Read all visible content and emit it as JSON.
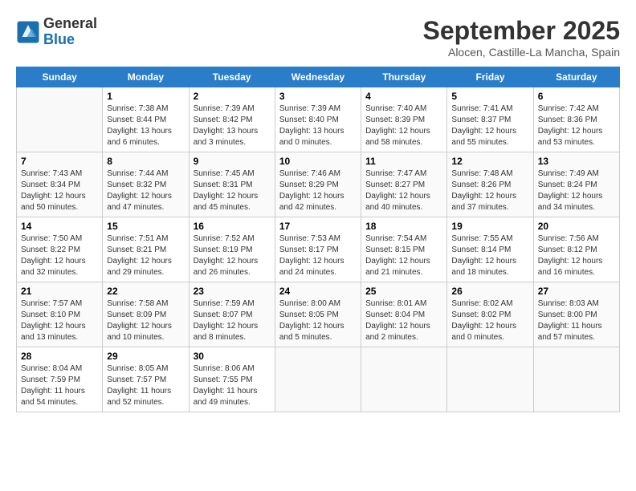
{
  "header": {
    "logo_general": "General",
    "logo_blue": "Blue",
    "month_title": "September 2025",
    "location": "Alocen, Castille-La Mancha, Spain"
  },
  "days_of_week": [
    "Sunday",
    "Monday",
    "Tuesday",
    "Wednesday",
    "Thursday",
    "Friday",
    "Saturday"
  ],
  "weeks": [
    [
      {
        "day": "",
        "info": ""
      },
      {
        "day": "1",
        "info": "Sunrise: 7:38 AM\nSunset: 8:44 PM\nDaylight: 13 hours\nand 6 minutes."
      },
      {
        "day": "2",
        "info": "Sunrise: 7:39 AM\nSunset: 8:42 PM\nDaylight: 13 hours\nand 3 minutes."
      },
      {
        "day": "3",
        "info": "Sunrise: 7:39 AM\nSunset: 8:40 PM\nDaylight: 13 hours\nand 0 minutes."
      },
      {
        "day": "4",
        "info": "Sunrise: 7:40 AM\nSunset: 8:39 PM\nDaylight: 12 hours\nand 58 minutes."
      },
      {
        "day": "5",
        "info": "Sunrise: 7:41 AM\nSunset: 8:37 PM\nDaylight: 12 hours\nand 55 minutes."
      },
      {
        "day": "6",
        "info": "Sunrise: 7:42 AM\nSunset: 8:36 PM\nDaylight: 12 hours\nand 53 minutes."
      }
    ],
    [
      {
        "day": "7",
        "info": "Sunrise: 7:43 AM\nSunset: 8:34 PM\nDaylight: 12 hours\nand 50 minutes."
      },
      {
        "day": "8",
        "info": "Sunrise: 7:44 AM\nSunset: 8:32 PM\nDaylight: 12 hours\nand 47 minutes."
      },
      {
        "day": "9",
        "info": "Sunrise: 7:45 AM\nSunset: 8:31 PM\nDaylight: 12 hours\nand 45 minutes."
      },
      {
        "day": "10",
        "info": "Sunrise: 7:46 AM\nSunset: 8:29 PM\nDaylight: 12 hours\nand 42 minutes."
      },
      {
        "day": "11",
        "info": "Sunrise: 7:47 AM\nSunset: 8:27 PM\nDaylight: 12 hours\nand 40 minutes."
      },
      {
        "day": "12",
        "info": "Sunrise: 7:48 AM\nSunset: 8:26 PM\nDaylight: 12 hours\nand 37 minutes."
      },
      {
        "day": "13",
        "info": "Sunrise: 7:49 AM\nSunset: 8:24 PM\nDaylight: 12 hours\nand 34 minutes."
      }
    ],
    [
      {
        "day": "14",
        "info": "Sunrise: 7:50 AM\nSunset: 8:22 PM\nDaylight: 12 hours\nand 32 minutes."
      },
      {
        "day": "15",
        "info": "Sunrise: 7:51 AM\nSunset: 8:21 PM\nDaylight: 12 hours\nand 29 minutes."
      },
      {
        "day": "16",
        "info": "Sunrise: 7:52 AM\nSunset: 8:19 PM\nDaylight: 12 hours\nand 26 minutes."
      },
      {
        "day": "17",
        "info": "Sunrise: 7:53 AM\nSunset: 8:17 PM\nDaylight: 12 hours\nand 24 minutes."
      },
      {
        "day": "18",
        "info": "Sunrise: 7:54 AM\nSunset: 8:15 PM\nDaylight: 12 hours\nand 21 minutes."
      },
      {
        "day": "19",
        "info": "Sunrise: 7:55 AM\nSunset: 8:14 PM\nDaylight: 12 hours\nand 18 minutes."
      },
      {
        "day": "20",
        "info": "Sunrise: 7:56 AM\nSunset: 8:12 PM\nDaylight: 12 hours\nand 16 minutes."
      }
    ],
    [
      {
        "day": "21",
        "info": "Sunrise: 7:57 AM\nSunset: 8:10 PM\nDaylight: 12 hours\nand 13 minutes."
      },
      {
        "day": "22",
        "info": "Sunrise: 7:58 AM\nSunset: 8:09 PM\nDaylight: 12 hours\nand 10 minutes."
      },
      {
        "day": "23",
        "info": "Sunrise: 7:59 AM\nSunset: 8:07 PM\nDaylight: 12 hours\nand 8 minutes."
      },
      {
        "day": "24",
        "info": "Sunrise: 8:00 AM\nSunset: 8:05 PM\nDaylight: 12 hours\nand 5 minutes."
      },
      {
        "day": "25",
        "info": "Sunrise: 8:01 AM\nSunset: 8:04 PM\nDaylight: 12 hours\nand 2 minutes."
      },
      {
        "day": "26",
        "info": "Sunrise: 8:02 AM\nSunset: 8:02 PM\nDaylight: 12 hours\nand 0 minutes."
      },
      {
        "day": "27",
        "info": "Sunrise: 8:03 AM\nSunset: 8:00 PM\nDaylight: 11 hours\nand 57 minutes."
      }
    ],
    [
      {
        "day": "28",
        "info": "Sunrise: 8:04 AM\nSunset: 7:59 PM\nDaylight: 11 hours\nand 54 minutes."
      },
      {
        "day": "29",
        "info": "Sunrise: 8:05 AM\nSunset: 7:57 PM\nDaylight: 11 hours\nand 52 minutes."
      },
      {
        "day": "30",
        "info": "Sunrise: 8:06 AM\nSunset: 7:55 PM\nDaylight: 11 hours\nand 49 minutes."
      },
      {
        "day": "",
        "info": ""
      },
      {
        "day": "",
        "info": ""
      },
      {
        "day": "",
        "info": ""
      },
      {
        "day": "",
        "info": ""
      }
    ]
  ]
}
